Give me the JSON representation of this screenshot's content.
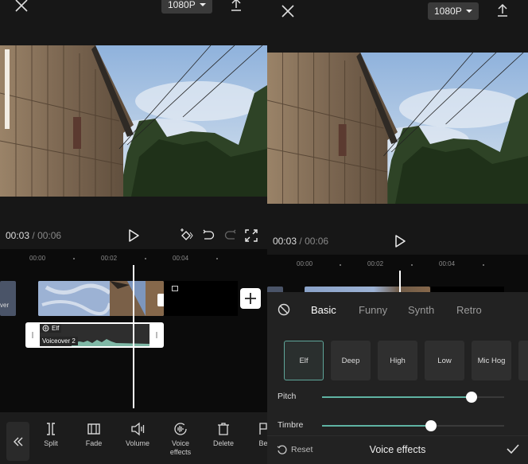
{
  "left_screen": {
    "topbar": {
      "resolution": "1080P",
      "close_icon": "close-icon",
      "export_icon": "upload-icon"
    },
    "playback": {
      "current_time": "00:03",
      "separator": "/",
      "total_time": "00:06"
    },
    "timeline": {
      "ruler": [
        "00:00",
        "00:02",
        "00:04"
      ],
      "cover_label": "ver",
      "audio_clip": {
        "effect_tag": "Elf",
        "name": "Voiceover 2"
      }
    },
    "toolbar": {
      "back_icon": "double-chevron-left-icon",
      "tools": [
        {
          "label": "Split",
          "icon": "split-icon"
        },
        {
          "label": "Fade",
          "icon": "fade-icon"
        },
        {
          "label": "Volume",
          "icon": "volume-icon"
        },
        {
          "label": "Voice effects",
          "icon": "voice-effects-icon"
        },
        {
          "label": "Delete",
          "icon": "delete-icon"
        },
        {
          "label": "Be",
          "icon": "beat-icon"
        }
      ]
    }
  },
  "right_screen": {
    "topbar": {
      "resolution": "1080P"
    },
    "playback": {
      "current_time": "00:03",
      "separator": "/",
      "total_time": "00:06"
    },
    "timeline": {
      "ruler": [
        "00:00",
        "00:02",
        "00:04"
      ]
    },
    "voice_panel": {
      "tabs": [
        {
          "label": "Basic",
          "active": true
        },
        {
          "label": "Funny",
          "active": false
        },
        {
          "label": "Synth",
          "active": false
        },
        {
          "label": "Retro",
          "active": false
        }
      ],
      "effects": [
        {
          "label": "Elf",
          "selected": true
        },
        {
          "label": "Deep",
          "selected": false
        },
        {
          "label": "High",
          "selected": false
        },
        {
          "label": "Low",
          "selected": false
        },
        {
          "label": "Mic Hog",
          "selected": false
        },
        {
          "label": "",
          "selected": false
        }
      ],
      "sliders": [
        {
          "label": "Pitch",
          "value_pct": 82
        },
        {
          "label": "Timbre",
          "value_pct": 60
        }
      ],
      "footer": {
        "reset_label": "Reset",
        "title": "Voice effects"
      }
    }
  },
  "colors": {
    "accent": "#5fb3a3",
    "background": "#171717",
    "panel": "#222222",
    "timeline": "#0b0b0b"
  }
}
